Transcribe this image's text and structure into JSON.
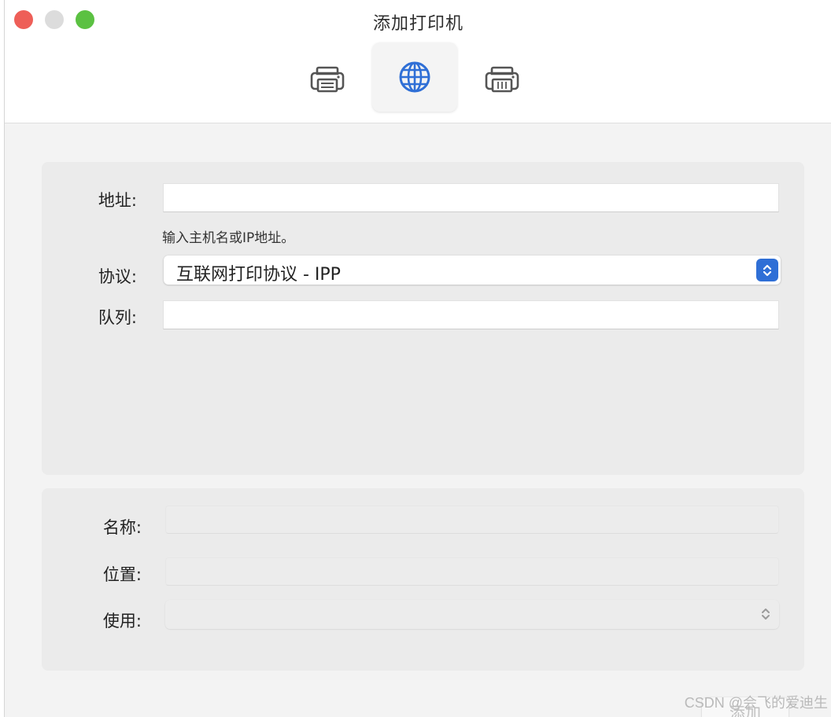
{
  "window": {
    "title": "添加打印机"
  },
  "toolbar": {
    "tabs": [
      {
        "icon": "printer-icon",
        "selected": false
      },
      {
        "icon": "globe-icon",
        "selected": true
      },
      {
        "icon": "fax-printer-icon",
        "selected": false
      }
    ]
  },
  "form": {
    "address_label": "地址:",
    "address_value": "",
    "address_hint": "输入主机名或IP地址。",
    "protocol_label": "协议:",
    "protocol_value": "互联网打印协议 - IPP",
    "queue_label": "队列:",
    "queue_value": ""
  },
  "details": {
    "name_label": "名称:",
    "name_value": "",
    "location_label": "位置:",
    "location_value": "",
    "use_label": "使用:",
    "use_value": ""
  },
  "footer": {
    "add_button_label": "添加",
    "watermark": "CSDN @会飞的爱迪生"
  },
  "colors": {
    "accent": "#2f6fd6",
    "close": "#ee5f58",
    "zoom": "#5bc142",
    "minimize_inactive": "#dcdcdc"
  }
}
